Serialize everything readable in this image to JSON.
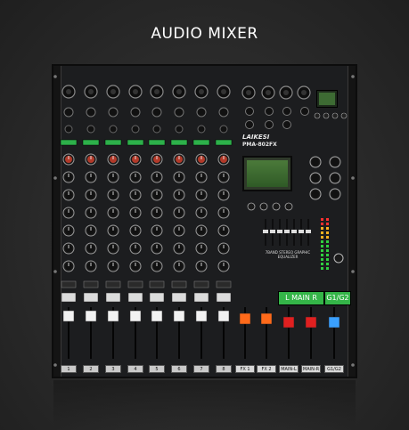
{
  "page": {
    "title": "AUDIO MIXER"
  },
  "mixer": {
    "brand": "LAIKESI",
    "model": "PMA-802FX",
    "main_button_label": "L MAIN R",
    "group_button_label": "G1/G2",
    "eq_caption": "7BAND STEREO GRAPHIC EQUALIZER",
    "mono_channels": [
      "1",
      "2",
      "3",
      "4",
      "5",
      "6",
      "7",
      "8"
    ],
    "bus_labels": [
      "FX 1",
      "FX 2",
      "MAIN-L",
      "MAIN-R",
      "G1/G2"
    ],
    "colors": {
      "green_button": "#2db04a",
      "fader_white": "#f2f2f2",
      "fader_orange": "#ff6a1a",
      "fader_red": "#e02020",
      "fader_blue": "#3aa0ff",
      "lcd": "#3d6b33"
    }
  }
}
